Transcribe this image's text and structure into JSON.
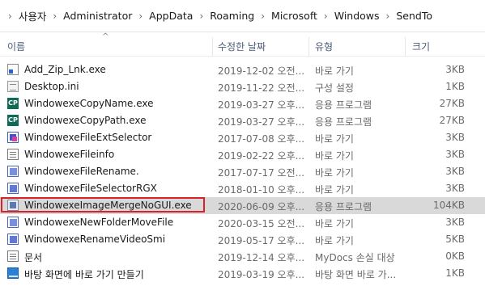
{
  "breadcrumb": [
    "사용자",
    "Administrator",
    "AppData",
    "Roaming",
    "Microsoft",
    "Windows",
    "SendTo"
  ],
  "columns": {
    "name": "이름",
    "date": "수정한 날짜",
    "type": "유형",
    "size": "크기"
  },
  "sort_indicator": "^",
  "files": [
    {
      "name": "Add_Zip_Lnk.exe",
      "date": "2019-12-02 오전...",
      "type": "바로 가기",
      "size": "3KB",
      "icon": "shortcut-icon"
    },
    {
      "name": "Desktop.ini",
      "date": "2019-11-22 오전...",
      "type": "구성 설정",
      "size": "1KB",
      "icon": "ini-file-icon"
    },
    {
      "name": "WindowexeCopyName.exe",
      "date": "2019-03-27 오후...",
      "type": "응용 프로그램",
      "size": "27KB",
      "icon": "cp-app-icon"
    },
    {
      "name": "WindowexeCopyPath.exe",
      "date": "2019-03-27 오후...",
      "type": "응용 프로그램",
      "size": "27KB",
      "icon": "cp-app-icon"
    },
    {
      "name": "WindowexeFileExtSelector",
      "date": "2017-07-08 오후...",
      "type": "바로 가기",
      "size": "3KB",
      "icon": "f-app-icon"
    },
    {
      "name": "WindowexeFileinfo",
      "date": "2019-02-22 오후...",
      "type": "바로 가기",
      "size": "3KB",
      "icon": "document-icon"
    },
    {
      "name": "WindowexeFileRename.",
      "date": "2017-07-17 오전...",
      "type": "바로 가기",
      "size": "3KB",
      "icon": "rename-app-icon"
    },
    {
      "name": "WindowexeFileSelectorRGX",
      "date": "2018-01-10 오후...",
      "type": "바로 가기",
      "size": "3KB",
      "icon": "rs-app-icon"
    },
    {
      "name": "WindowexeImageMergeNoGUI.exe",
      "date": "2020-06-09 오후...",
      "type": "응용 프로그램",
      "size": "104KB",
      "icon": "exe-app-icon",
      "selected": true
    },
    {
      "name": "WindowexeNewFolderMoveFile",
      "date": "2020-03-15 오전...",
      "type": "바로 가기",
      "size": "3KB",
      "icon": "new-folder-app-icon"
    },
    {
      "name": "WindowexeRenameVideoSmi",
      "date": "2019-05-17 오후...",
      "type": "바로 가기",
      "size": "5KB",
      "icon": "rs-app-icon"
    },
    {
      "name": "문서",
      "date": "2019-12-14 오후...",
      "type": "MyDocs 손실 대상",
      "size": "0KB",
      "icon": "document-icon"
    },
    {
      "name": "바탕 화면에 바로 가기 만들기",
      "date": "2019-03-19 오후...",
      "type": "바탕 화면 바로 가...",
      "size": "1KB",
      "icon": "desktop-shortcut-icon"
    }
  ],
  "colors": {
    "selection": "#d9d9d9",
    "highlight_border": "#d8222a",
    "header_text": "#4a5a78"
  }
}
